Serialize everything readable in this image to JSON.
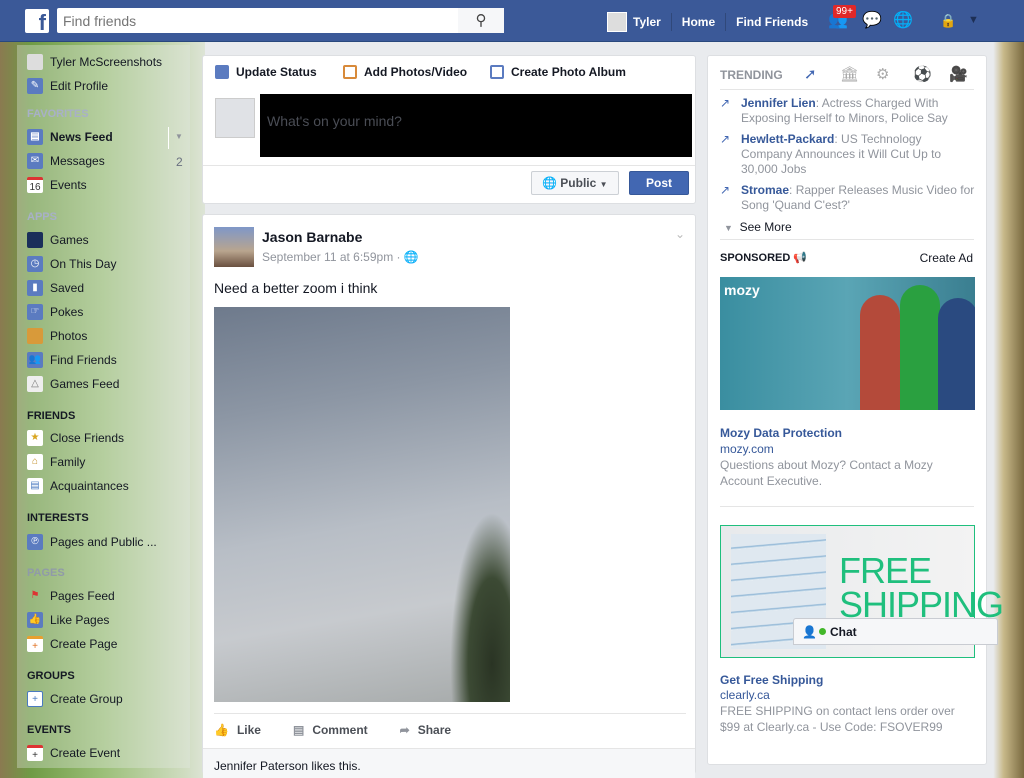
{
  "topbar": {
    "search_placeholder": "Find friends",
    "user": "Tyler",
    "home": "Home",
    "find_friends": "Find Friends",
    "notification_badge": "99+"
  },
  "sidebar": {
    "profile": "Tyler McScreenshots",
    "edit_profile": "Edit Profile",
    "favorites_header": "FAVORITES",
    "favorites": [
      {
        "label": "News Feed",
        "icon": "news-feed-icon"
      },
      {
        "label": "Messages",
        "count": "2",
        "icon": "messages-icon"
      },
      {
        "label": "Events",
        "icon": "calendar-icon",
        "icon_text": "16"
      }
    ],
    "apps_header": "APPS",
    "apps": [
      {
        "label": "Games"
      },
      {
        "label": "On This Day"
      },
      {
        "label": "Saved"
      },
      {
        "label": "Pokes"
      },
      {
        "label": "Photos"
      },
      {
        "label": "Find Friends"
      },
      {
        "label": "Games Feed"
      }
    ],
    "friends_header": "FRIENDS",
    "friends": [
      {
        "label": "Close Friends"
      },
      {
        "label": "Family"
      },
      {
        "label": "Acquaintances"
      }
    ],
    "interests_header": "INTERESTS",
    "interests": [
      {
        "label": "Pages and Public ..."
      }
    ],
    "pages_header": "PAGES",
    "pages": [
      {
        "label": "Pages Feed"
      },
      {
        "label": "Like Pages"
      },
      {
        "label": "Create Page"
      }
    ],
    "groups_header": "GROUPS",
    "groups": [
      {
        "label": "Create Group"
      }
    ],
    "events_header": "EVENTS",
    "events": [
      {
        "label": "Create Event"
      }
    ]
  },
  "composer": {
    "tabs": [
      "Update Status",
      "Add Photos/Video",
      "Create Photo Album"
    ],
    "placeholder": "What's on your mind?",
    "privacy": "Public",
    "post": "Post"
  },
  "story": {
    "author": "Jason Barnabe",
    "time": "September 11 at 6:59pm",
    "text": "Need a better zoom i think",
    "actions": [
      "Like",
      "Comment",
      "Share"
    ],
    "likes": "Jennifer Paterson likes this."
  },
  "trending": {
    "header": "TRENDING",
    "items": [
      {
        "topic": "Jennifer Lien",
        "desc": ": Actress Charged With Exposing Herself to Minors, Police Say"
      },
      {
        "topic": "Hewlett-Packard",
        "desc": ": US Technology Company Announces it Will Cut Up to 30,000 Jobs"
      },
      {
        "topic": "Stromae",
        "desc": ": Rapper Releases Music Video for Song 'Quand C'est?'"
      }
    ],
    "see_more": "See More"
  },
  "sponsored": {
    "header": "SPONSORED",
    "create_ad": "Create Ad",
    "ads": [
      {
        "logo": "mozy",
        "title": "Mozy Data Protection",
        "url": "mozy.com",
        "desc": "Questions about Mozy? Contact a Mozy Account Executive."
      },
      {
        "image_text": "FREE SHIPPING",
        "title": "Get Free Shipping",
        "url": "clearly.ca",
        "desc": "FREE SHIPPING on contact lens order over $99 at Clearly.ca - Use Code: FSOVER99"
      }
    ]
  },
  "chat": {
    "label": "Chat"
  }
}
